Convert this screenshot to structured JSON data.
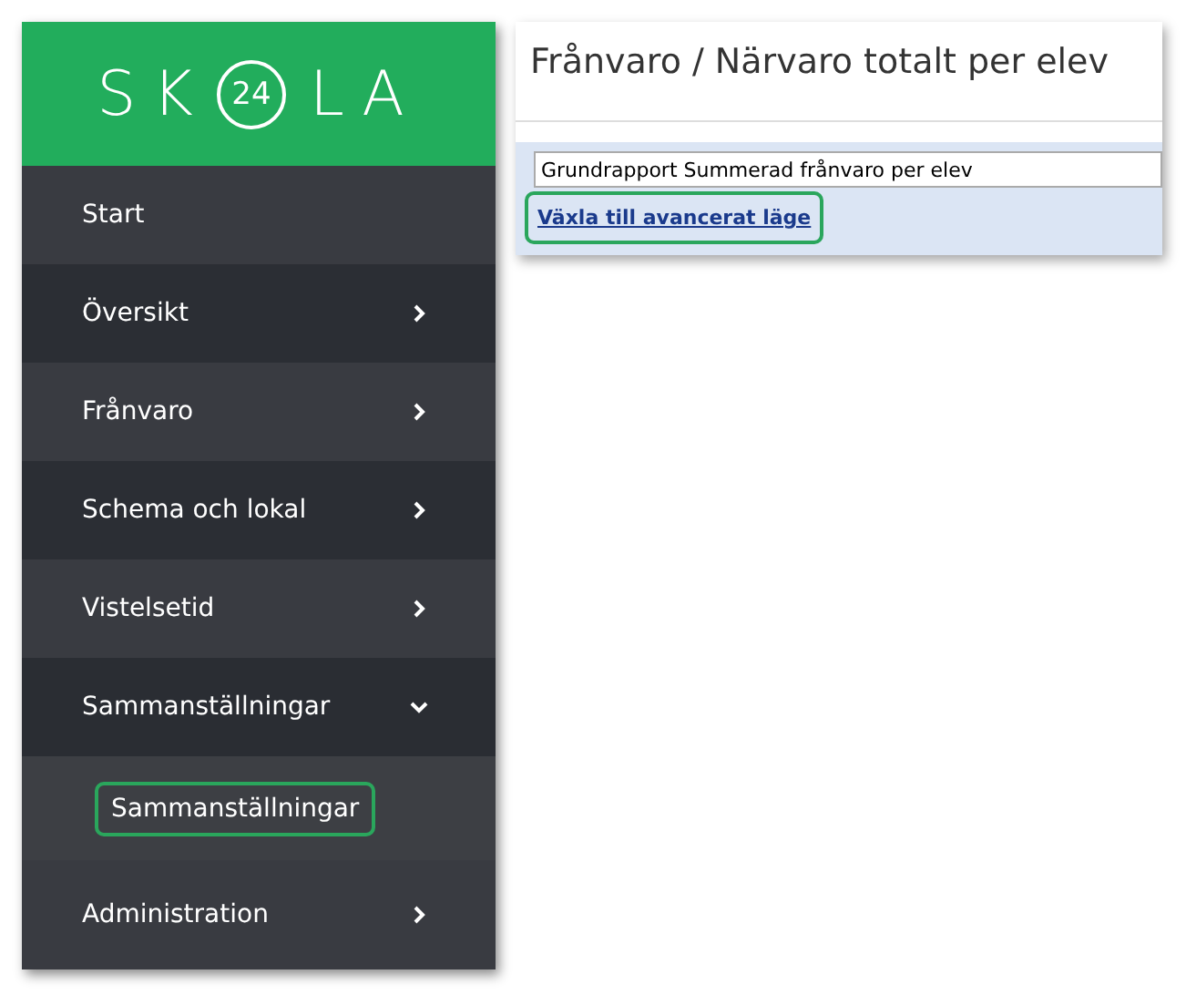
{
  "sidebar": {
    "logo": {
      "left": "SK",
      "badge": "24",
      "right": "LA"
    },
    "items": [
      {
        "label": "Start",
        "kind": "link",
        "expanded": false
      },
      {
        "label": "Översikt",
        "kind": "menu",
        "expanded": false
      },
      {
        "label": "Frånvaro",
        "kind": "menu",
        "expanded": false
      },
      {
        "label": "Schema och lokal",
        "kind": "menu",
        "expanded": false
      },
      {
        "label": "Vistelsetid",
        "kind": "menu",
        "expanded": false
      },
      {
        "label": "Sammanställningar",
        "kind": "menu",
        "expanded": true,
        "children": [
          {
            "label": "Sammanställningar",
            "highlighted": true
          }
        ]
      },
      {
        "label": "Administration",
        "kind": "menu",
        "expanded": false
      }
    ]
  },
  "report": {
    "title": "Frånvaro / Närvaro totalt per elev",
    "report_field": {
      "value": "Grundrapport Summerad frånvaro per elev"
    },
    "mode_link": {
      "label": "Växla till avancerat läge",
      "highlighted": true
    }
  }
}
